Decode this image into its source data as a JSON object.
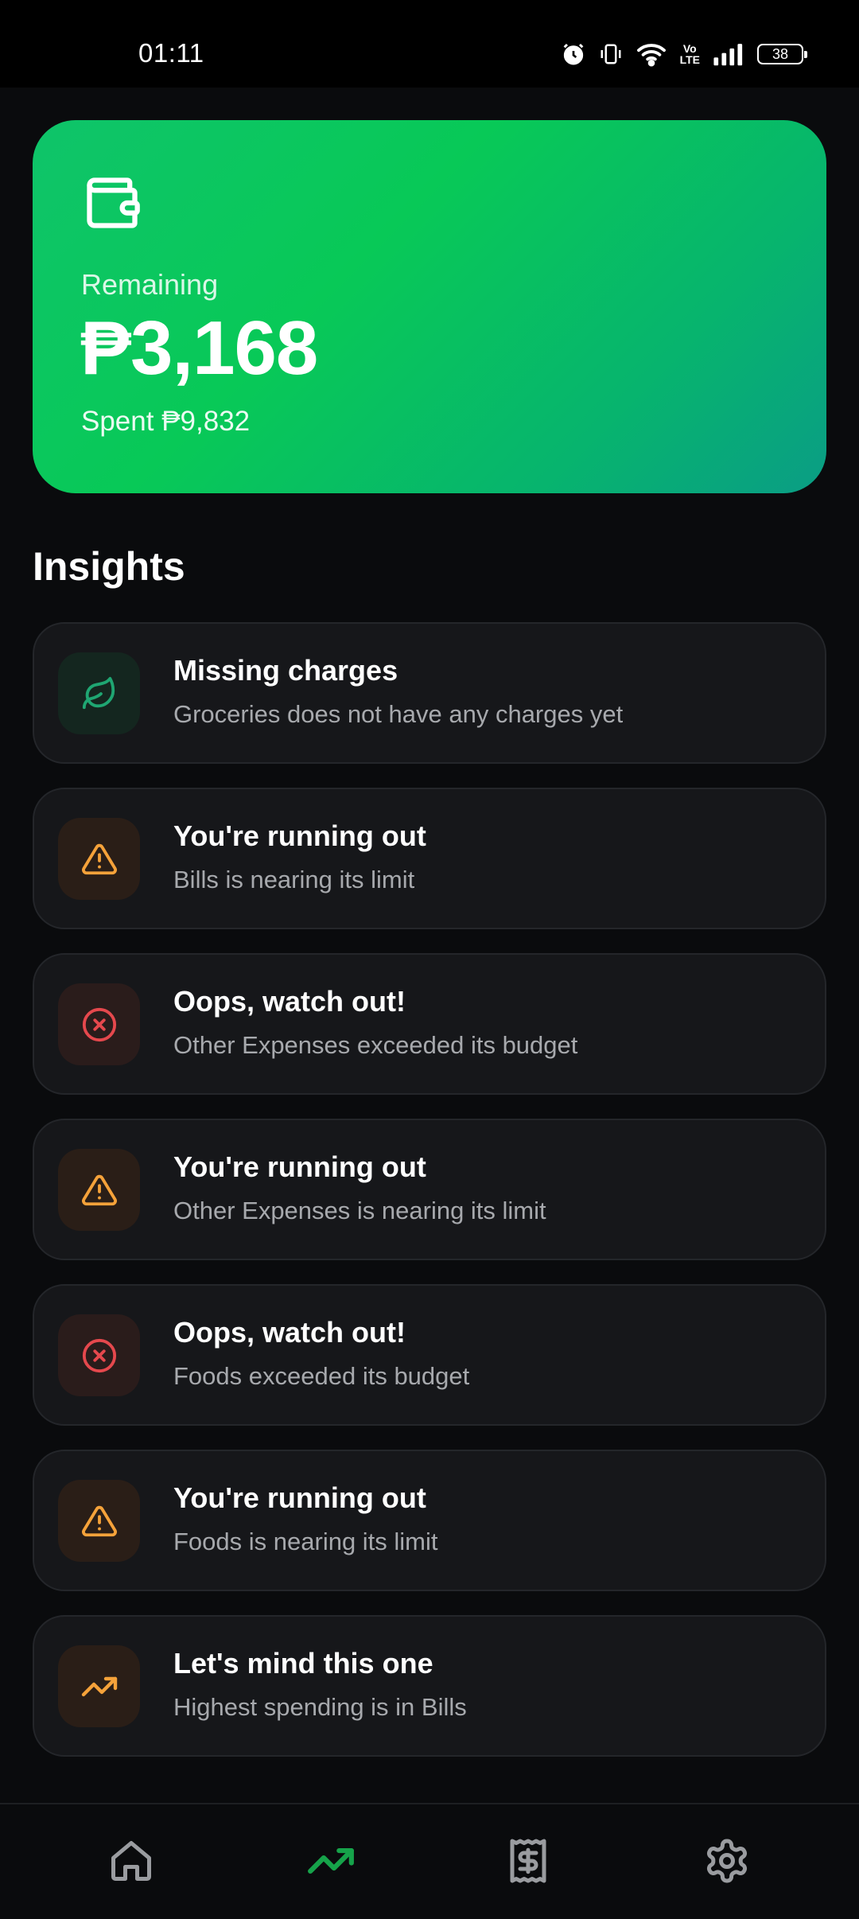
{
  "status_bar": {
    "time": "01:11",
    "battery": "38",
    "icons": [
      "alarm-icon",
      "vibrate-icon",
      "wifi-icon",
      "volte-icon",
      "signal-icon",
      "battery-icon"
    ],
    "volte_top": "Vo",
    "volte_bottom": "LTE"
  },
  "summary": {
    "icon": "wallet-icon",
    "label": "Remaining",
    "amount": "₱3,168",
    "spent": "Spent ₱9,832",
    "gradient_colors": [
      "#0fc46a",
      "#0a9d85"
    ]
  },
  "insights_title": "Insights",
  "insights": [
    {
      "title": "Missing charges",
      "description": "Groceries does not have any charges yet",
      "icon": "leaf-icon",
      "color": "#1fa672",
      "bg": "#14261f"
    },
    {
      "title": "You're running out",
      "description": "Bills is nearing its limit",
      "icon": "warning-icon",
      "color": "#f5a23a",
      "bg": "#2a1e17"
    },
    {
      "title": "Oops, watch out!",
      "description": "Other Expenses exceeded its budget",
      "icon": "error-circle-icon",
      "color": "#e5484d",
      "bg": "#2a1c1b"
    },
    {
      "title": "You're running out",
      "description": "Other Expenses is nearing its limit",
      "icon": "warning-icon",
      "color": "#f5a23a",
      "bg": "#2a1e17"
    },
    {
      "title": "Oops, watch out!",
      "description": "Foods exceeded its budget",
      "icon": "error-circle-icon",
      "color": "#e5484d",
      "bg": "#2a1c1b"
    },
    {
      "title": "You're running out",
      "description": "Foods is nearing its limit",
      "icon": "warning-icon",
      "color": "#f5a23a",
      "bg": "#2a1e17"
    },
    {
      "title": "Let's mind this one",
      "description": "Highest spending is in Bills",
      "icon": "trending-up-icon",
      "color": "#f5a23a",
      "bg": "#2a1e17"
    }
  ],
  "bottom_nav": {
    "items": [
      {
        "icon": "home-icon",
        "active": false
      },
      {
        "icon": "trending-up-icon",
        "active": true
      },
      {
        "icon": "receipt-icon",
        "active": false
      },
      {
        "icon": "settings-icon",
        "active": false
      }
    ],
    "active_color": "#16a34a",
    "inactive_color": "#9a9ca0"
  }
}
